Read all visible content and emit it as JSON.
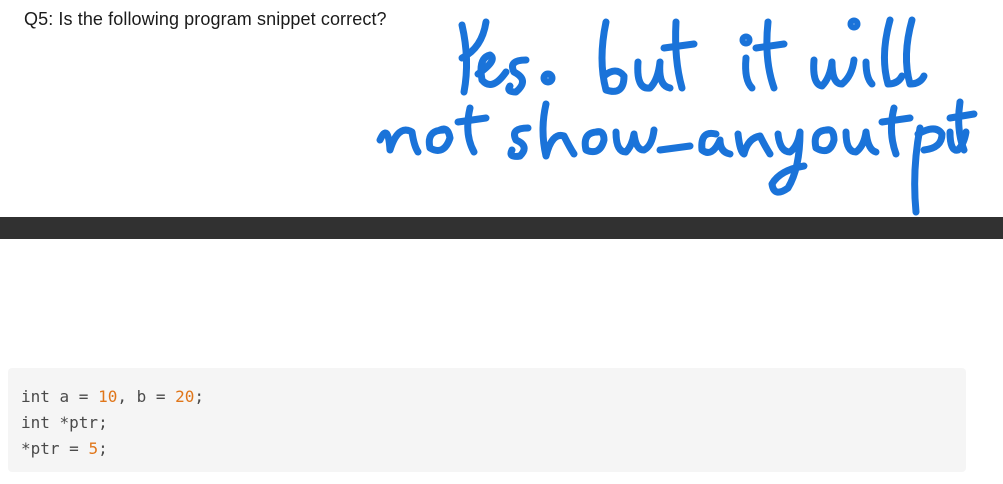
{
  "question": {
    "text": "Q5: Is the following program snippet correct?"
  },
  "handwritten_answer": {
    "line1": "Yes, but it will",
    "line2": "not show any output",
    "ink_color": "#1a73d9"
  },
  "code": {
    "lines": [
      [
        "int a = ",
        "10",
        ", b = ",
        "20",
        ";"
      ],
      [
        "int *ptr;"
      ],
      [
        "*ptr = ",
        "5",
        ";"
      ]
    ],
    "number_color": "#e0761a"
  }
}
